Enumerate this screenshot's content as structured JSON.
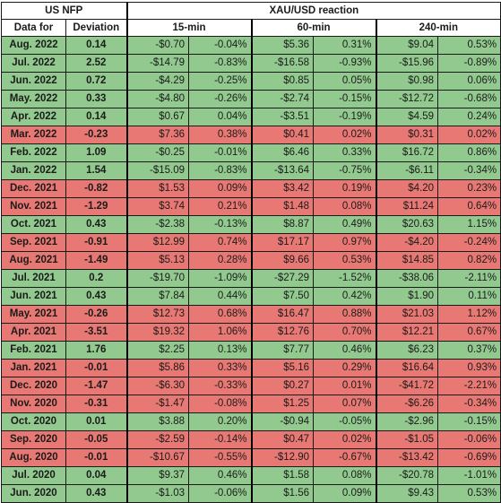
{
  "header": {
    "left_group": "US NFP",
    "right_group": "XAU/USD reaction",
    "col_month": "Data for",
    "col_deviation": "Deviation",
    "sub_15": "15-min",
    "sub_60": "60-min",
    "sub_240": "240-min"
  },
  "colors": {
    "positive_row": "#92c98f",
    "negative_row": "#e87873",
    "grid": "#1a1a1a",
    "text": "#1b1b1b",
    "header_bg": "#ffffff"
  },
  "chart_data": {
    "type": "table",
    "title": "US NFP deviation vs XAU/USD reaction",
    "columns": [
      "Data for",
      "Deviation",
      "15-min $",
      "15-min %",
      "60-min $",
      "60-min %",
      "240-min $",
      "240-min %"
    ],
    "rows": [
      {
        "month": "Aug. 2022",
        "deviation": "0.14",
        "sign": "pos",
        "m15_val": "-$0.70",
        "m15_pct": "-0.04%",
        "m60_val": "$5.36",
        "m60_pct": "0.31%",
        "m240_val": "$9.04",
        "m240_pct": "0.53%"
      },
      {
        "month": "Jul. 2022",
        "deviation": "2.52",
        "sign": "pos",
        "m15_val": "-$14.79",
        "m15_pct": "-0.83%",
        "m60_val": "-$16.58",
        "m60_pct": "-0.93%",
        "m240_val": "-$15.96",
        "m240_pct": "-0.89%"
      },
      {
        "month": "Jun. 2022",
        "deviation": "0.72",
        "sign": "pos",
        "m15_val": "-$4.29",
        "m15_pct": "-0.25%",
        "m60_val": "$0.85",
        "m60_pct": "0.05%",
        "m240_val": "$0.98",
        "m240_pct": "0.06%"
      },
      {
        "month": "May. 2022",
        "deviation": "0.33",
        "sign": "pos",
        "m15_val": "-$4.80",
        "m15_pct": "-0.26%",
        "m60_val": "-$2.74",
        "m60_pct": "-0.15%",
        "m240_val": "-$12.72",
        "m240_pct": "-0.68%"
      },
      {
        "month": "Apr. 2022",
        "deviation": "0.14",
        "sign": "pos",
        "m15_val": "$0.67",
        "m15_pct": "0.04%",
        "m60_val": "-$3.51",
        "m60_pct": "-0.19%",
        "m240_val": "$4.59",
        "m240_pct": "0.24%"
      },
      {
        "month": "Mar. 2022",
        "deviation": "-0.23",
        "sign": "neg",
        "m15_val": "$7.36",
        "m15_pct": "0.38%",
        "m60_val": "$0.41",
        "m60_pct": "0.02%",
        "m240_val": "$0.31",
        "m240_pct": "0.02%"
      },
      {
        "month": "Feb. 2022",
        "deviation": "1.09",
        "sign": "pos",
        "m15_val": "-$0.25",
        "m15_pct": "-0.01%",
        "m60_val": "$6.46",
        "m60_pct": "0.33%",
        "m240_val": "$16.72",
        "m240_pct": "0.86%"
      },
      {
        "month": "Jan. 2022",
        "deviation": "1.54",
        "sign": "pos",
        "m15_val": "-$15.09",
        "m15_pct": "-0.83%",
        "m60_val": "-$13.64",
        "m60_pct": "-0.75%",
        "m240_val": "-$6.11",
        "m240_pct": "-0.34%"
      },
      {
        "month": "Dec. 2021",
        "deviation": "-0.82",
        "sign": "neg",
        "m15_val": "$1.53",
        "m15_pct": "0.09%",
        "m60_val": "$3.42",
        "m60_pct": "0.19%",
        "m240_val": "$4.20",
        "m240_pct": "0.23%"
      },
      {
        "month": "Nov. 2021",
        "deviation": "-1.29",
        "sign": "neg",
        "m15_val": "$3.74",
        "m15_pct": "0.21%",
        "m60_val": "$1.48",
        "m60_pct": "0.08%",
        "m240_val": "$11.24",
        "m240_pct": "0.64%"
      },
      {
        "month": "Oct. 2021",
        "deviation": "0.43",
        "sign": "pos",
        "m15_val": "-$2.38",
        "m15_pct": "-0.13%",
        "m60_val": "$8.87",
        "m60_pct": "0.49%",
        "m240_val": "$20.63",
        "m240_pct": "1.15%"
      },
      {
        "month": "Sep. 2021",
        "deviation": "-0.91",
        "sign": "neg",
        "m15_val": "$12.99",
        "m15_pct": "0.74%",
        "m60_val": "$17.17",
        "m60_pct": "0.97%",
        "m240_val": "-$4.20",
        "m240_pct": "-0.24%"
      },
      {
        "month": "Aug. 2021",
        "deviation": "-1.49",
        "sign": "neg",
        "m15_val": "$5.13",
        "m15_pct": "0.28%",
        "m60_val": "$9.66",
        "m60_pct": "0.53%",
        "m240_val": "$14.85",
        "m240_pct": "0.82%"
      },
      {
        "month": "Jul. 2021",
        "deviation": "0.2",
        "sign": "pos",
        "m15_val": "-$19.70",
        "m15_pct": "-1.09%",
        "m60_val": "-$27.29",
        "m60_pct": "-1.52%",
        "m240_val": "-$38.06",
        "m240_pct": "-2.11%"
      },
      {
        "month": "Jun. 2021",
        "deviation": "0.43",
        "sign": "pos",
        "m15_val": "$7.84",
        "m15_pct": "0.44%",
        "m60_val": "$7.50",
        "m60_pct": "0.42%",
        "m240_val": "$1.90",
        "m240_pct": "0.11%"
      },
      {
        "month": "May. 2021",
        "deviation": "-0.26",
        "sign": "neg",
        "m15_val": "$12.73",
        "m15_pct": "0.68%",
        "m60_val": "$16.47",
        "m60_pct": "0.88%",
        "m240_val": "$21.03",
        "m240_pct": "1.12%"
      },
      {
        "month": "Apr. 2021",
        "deviation": "-3.51",
        "sign": "neg",
        "m15_val": "$19.32",
        "m15_pct": "1.06%",
        "m60_val": "$12.76",
        "m60_pct": "0.70%",
        "m240_val": "$12.21",
        "m240_pct": "0.67%"
      },
      {
        "month": "Feb. 2021",
        "deviation": "1.76",
        "sign": "pos",
        "m15_val": "$2.25",
        "m15_pct": "0.13%",
        "m60_val": "$7.77",
        "m60_pct": "0.46%",
        "m240_val": "$6.23",
        "m240_pct": "0.37%"
      },
      {
        "month": "Jan. 2021",
        "deviation": "-0.01",
        "sign": "neg",
        "m15_val": "$5.86",
        "m15_pct": "0.33%",
        "m60_val": "$5.16",
        "m60_pct": "0.29%",
        "m240_val": "$16.64",
        "m240_pct": "0.93%"
      },
      {
        "month": "Dec. 2020",
        "deviation": "-1.47",
        "sign": "neg",
        "m15_val": "-$6.30",
        "m15_pct": "-0.33%",
        "m60_val": "$0.27",
        "m60_pct": "0.01%",
        "m240_val": "-$41.72",
        "m240_pct": "-2.21%"
      },
      {
        "month": "Nov. 2020",
        "deviation": "-0.31",
        "sign": "neg",
        "m15_val": "-$1.47",
        "m15_pct": "-0.08%",
        "m60_val": "$1.25",
        "m60_pct": "0.07%",
        "m240_val": "-$6.26",
        "m240_pct": "-0.34%"
      },
      {
        "month": "Oct. 2020",
        "deviation": "0.01",
        "sign": "pos",
        "m15_val": "$3.88",
        "m15_pct": "0.20%",
        "m60_val": "-$0.94",
        "m60_pct": "-0.05%",
        "m240_val": "-$2.96",
        "m240_pct": "-0.15%"
      },
      {
        "month": "Sep. 2020",
        "deviation": "-0.05",
        "sign": "neg",
        "m15_val": "-$2.59",
        "m15_pct": "-0.14%",
        "m60_val": "$0.47",
        "m60_pct": "0.02%",
        "m240_val": "-$1.05",
        "m240_pct": "-0.06%"
      },
      {
        "month": "Aug. 2020",
        "deviation": "-0.01",
        "sign": "neg",
        "m15_val": "-$10.67",
        "m15_pct": "-0.55%",
        "m60_val": "-$12.90",
        "m60_pct": "-0.67%",
        "m240_val": "-$13.42",
        "m240_pct": "-0.69%"
      },
      {
        "month": "Jul. 2020",
        "deviation": "0.04",
        "sign": "pos",
        "m15_val": "$9.37",
        "m15_pct": "0.46%",
        "m60_val": "$1.58",
        "m60_pct": "0.08%",
        "m240_val": "-$20.78",
        "m240_pct": "-1.01%"
      },
      {
        "month": "Jun. 2020",
        "deviation": "0.43",
        "sign": "pos",
        "m15_val": "-$1.03",
        "m15_pct": "-0.06%",
        "m60_val": "$1.56",
        "m60_pct": "0.09%",
        "m240_val": "$9.43",
        "m240_pct": "0.53%"
      }
    ]
  }
}
